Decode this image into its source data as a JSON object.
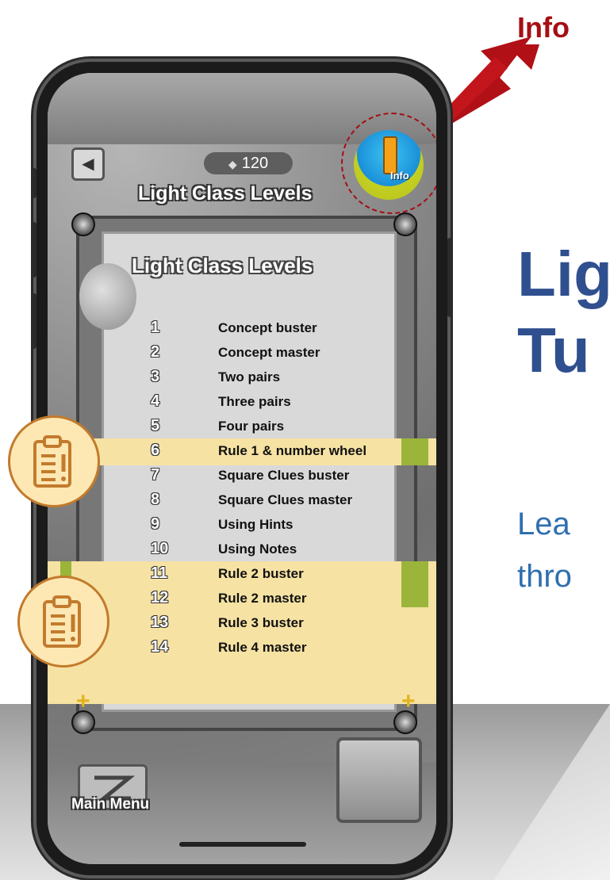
{
  "annotation": {
    "info_label": "Info",
    "side_title_line1": "Lig",
    "side_title_line2": "Tu",
    "side_sub_line1": "Lea",
    "side_sub_line2": "thro",
    "accent_color": "#a50f14",
    "title_color": "#2f4f8f"
  },
  "game": {
    "back_icon": "back-arrow-icon",
    "score": "120",
    "screen_title": "Light Class Levels",
    "info_button_label": "Info",
    "panel_title": "Light Class Levels",
    "levels": [
      {
        "num": "1",
        "name": "Concept buster"
      },
      {
        "num": "2",
        "name": "Concept master"
      },
      {
        "num": "3",
        "name": "Two pairs"
      },
      {
        "num": "4",
        "name": "Three pairs"
      },
      {
        "num": "5",
        "name": "Four pairs"
      },
      {
        "num": "6",
        "name": "Rule 1 & number wheel"
      },
      {
        "num": "7",
        "name": "Square Clues buster"
      },
      {
        "num": "8",
        "name": "Square Clues master"
      },
      {
        "num": "9",
        "name": "Using Hints"
      },
      {
        "num": "10",
        "name": "Using Notes"
      },
      {
        "num": "11",
        "name": "Rule 2 buster"
      },
      {
        "num": "12",
        "name": "Rule 2 master"
      },
      {
        "num": "13",
        "name": "Rule 3 buster"
      },
      {
        "num": "14",
        "name": "Rule 4 master"
      }
    ],
    "main_menu_label": "Main Menu",
    "highlight_color": "#f6e2a3"
  }
}
